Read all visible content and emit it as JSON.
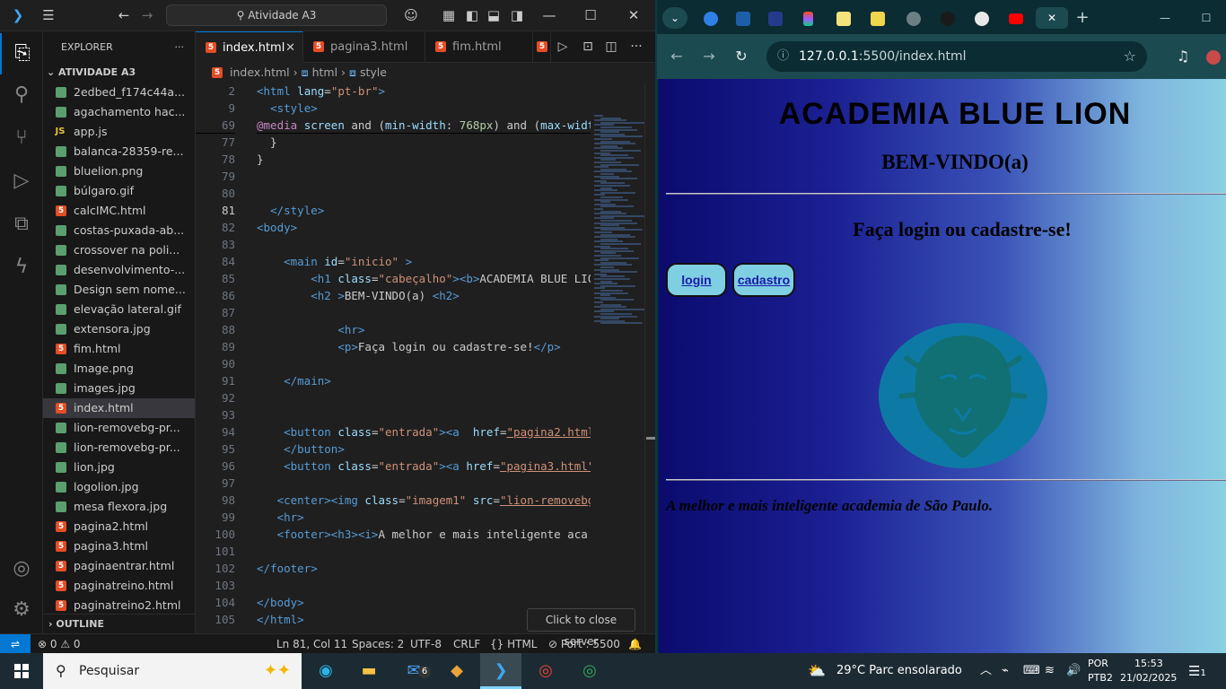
{
  "vscode": {
    "title_search": "Atividade A3",
    "explorer": {
      "header": "EXPLORER",
      "folder": "ATIVIDADE A3",
      "files": [
        {
          "name": "2edbed_f174c44a...",
          "type": "img"
        },
        {
          "name": "agachamento hac...",
          "type": "img"
        },
        {
          "name": "app.js",
          "type": "js"
        },
        {
          "name": "balanca-28359-re...",
          "type": "img"
        },
        {
          "name": "bluelion.png",
          "type": "img"
        },
        {
          "name": "búlgaro.gif",
          "type": "img"
        },
        {
          "name": "calcIMC.html",
          "type": "html"
        },
        {
          "name": "costas-puxada-ab...",
          "type": "img"
        },
        {
          "name": "crossover na poli...",
          "type": "img"
        },
        {
          "name": "desenvolvimento-...",
          "type": "img"
        },
        {
          "name": "Design sem nome...",
          "type": "img"
        },
        {
          "name": "elevação lateral.gif",
          "type": "img"
        },
        {
          "name": "extensora.jpg",
          "type": "img"
        },
        {
          "name": "fim.html",
          "type": "html"
        },
        {
          "name": "Image.png",
          "type": "img"
        },
        {
          "name": "images.jpg",
          "type": "img"
        },
        {
          "name": "index.html",
          "type": "html",
          "active": true
        },
        {
          "name": "lion-removebg-pr...",
          "type": "img"
        },
        {
          "name": "lion-removebg-pr...",
          "type": "img"
        },
        {
          "name": "lion.jpg",
          "type": "img"
        },
        {
          "name": "logolion.jpg",
          "type": "img"
        },
        {
          "name": "mesa flexora.jpg",
          "type": "img"
        },
        {
          "name": "pagina2.html",
          "type": "html"
        },
        {
          "name": "pagina3.html",
          "type": "html"
        },
        {
          "name": "paginaentrar.html",
          "type": "html"
        },
        {
          "name": "paginatreino.html",
          "type": "html"
        },
        {
          "name": "paginatreino2.html",
          "type": "html"
        }
      ],
      "outline": "OUTLINE"
    },
    "tabs": [
      {
        "label": "index.html",
        "active": true
      },
      {
        "label": "pagina3.html"
      },
      {
        "label": "fim.html"
      }
    ],
    "breadcrumb": [
      "index.html",
      "html",
      "style"
    ],
    "code": [
      {
        "n": "2",
        "html": "<span class='t-tag'>&lt;html</span> <span class='t-attr'>lang</span>=<span class='t-str'>\"pt-br\"</span><span class='t-tag'>&gt;</span>"
      },
      {
        "n": "9",
        "html": "  <span class='t-tag'>&lt;style&gt;</span>"
      },
      {
        "n": "69",
        "html": "<span class='t-key'>@media</span> <span class='t-attr'>screen</span> and (<span class='t-attr'>min-width</span>: <span class='t-num'>768px</span>) and (<span class='t-attr'>max-width</span>"
      },
      {
        "n": "77",
        "html": "  }"
      },
      {
        "n": "78",
        "html": "}"
      },
      {
        "n": "79",
        "html": ""
      },
      {
        "n": "80",
        "html": ""
      },
      {
        "n": "81",
        "html": "  <span class='t-tag'>&lt;/style&gt;</span>",
        "cur": true
      },
      {
        "n": "82",
        "html": "<span class='t-tag'>&lt;body&gt;</span>"
      },
      {
        "n": "83",
        "html": ""
      },
      {
        "n": "84",
        "html": "    <span class='t-tag'>&lt;main</span> <span class='t-attr'>id</span>=<span class='t-str'>\"inicio\"</span> <span class='t-tag'>&gt;</span>"
      },
      {
        "n": "85",
        "html": "        <span class='t-tag'>&lt;h1</span> <span class='t-attr'>class</span>=<span class='t-str'>\"cabeçalho\"</span><span class='t-tag'>&gt;&lt;b&gt;</span>ACADEMIA BLUE LION"
      },
      {
        "n": "86",
        "html": "        <span class='t-tag'>&lt;h2</span> <span class='t-tag'>&gt;</span>BEM-VINDO(a) <span class='t-tag'>&lt;h2&gt;</span>"
      },
      {
        "n": "87",
        "html": ""
      },
      {
        "n": "88",
        "html": "            <span class='t-tag'>&lt;hr&gt;</span>"
      },
      {
        "n": "89",
        "html": "            <span class='t-tag'>&lt;p&gt;</span>Faça login ou cadastre-se!<span class='t-tag'>&lt;/p&gt;</span>"
      },
      {
        "n": "90",
        "html": ""
      },
      {
        "n": "91",
        "html": "    <span class='t-tag'>&lt;/main&gt;</span>"
      },
      {
        "n": "92",
        "html": ""
      },
      {
        "n": "93",
        "html": ""
      },
      {
        "n": "94",
        "html": "    <span class='t-tag'>&lt;button</span> <span class='t-attr'>class</span>=<span class='t-str'>\"entrada\"</span><span class='t-tag'>&gt;&lt;a</span>  <span class='t-attr'>href</span>=<span class='t-lnk'>\"pagina2.html\"</span>"
      },
      {
        "n": "95",
        "html": "    <span class='t-tag'>&lt;/button&gt;</span>"
      },
      {
        "n": "96",
        "html": "    <span class='t-tag'>&lt;button</span> <span class='t-attr'>class</span>=<span class='t-str'>\"entrada\"</span><span class='t-tag'>&gt;&lt;a</span> <span class='t-attr'>href</span>=<span class='t-lnk'>\"pagina3.html\"</span>"
      },
      {
        "n": "97",
        "html": ""
      },
      {
        "n": "98",
        "html": "   <span class='t-tag'>&lt;center&gt;&lt;img</span> <span class='t-attr'>class</span>=<span class='t-str'>\"imagem1\"</span> <span class='t-attr'>src</span>=<span class='t-lnk'>\"lion-removebg</span>"
      },
      {
        "n": "99",
        "html": "   <span class='t-tag'>&lt;hr&gt;</span>"
      },
      {
        "n": "100",
        "html": "   <span class='t-tag'>&lt;footer&gt;&lt;h3&gt;&lt;i&gt;</span>A melhor e mais inteligente aca"
      },
      {
        "n": "101",
        "html": ""
      },
      {
        "n": "102",
        "html": "<span class='t-tag'>&lt;/footer&gt;</span>"
      },
      {
        "n": "103",
        "html": ""
      },
      {
        "n": "104",
        "html": "<span class='t-tag'>&lt;/body&gt;</span>"
      },
      {
        "n": "105",
        "html": "<span class='t-tag'>&lt;/html&gt;</span>"
      }
    ],
    "status": {
      "problems": "⊗ 0 ⚠ 0",
      "position": "Ln 81, Col 11",
      "spaces": "Spaces: 2",
      "encoding": "UTF-8",
      "eol": "CRLF",
      "language": "HTML",
      "port": "Port : 5500"
    },
    "tooltip": "Click to close server"
  },
  "chrome": {
    "url_host": "127.0.0.1",
    "url_rest": ":5500/index.html",
    "tab_favicons": [
      "bluesky-icon",
      "vscode-icon",
      "app-icon",
      "figma-icon",
      "notes-icon",
      "notes-icon",
      "globe-icon",
      "github-icon",
      "chatgpt-icon",
      "youtube-icon"
    ]
  },
  "page": {
    "h1": "ACADEMIA BLUE LION",
    "h2": "BEM-VINDO(a)",
    "p": "Faça login ou cadastre-se!",
    "btn_login": "login",
    "btn_cadastro": "cadastro",
    "footer": "A melhor e mais inteligente academia de São Paulo.",
    "colors": {
      "gradient_start": "#0b0b6e",
      "gradient_end": "#8ad0e3",
      "button": "#7fcfe3",
      "lion": "#0f7fa8"
    }
  },
  "taskbar": {
    "search_placeholder": "Pesquisar",
    "weather": "29°C  Parc ensolarado",
    "lang": "POR",
    "lang2": "PTB2",
    "time": "15:53",
    "date": "21/02/2025",
    "mail_badge": "6",
    "notif": "1"
  }
}
